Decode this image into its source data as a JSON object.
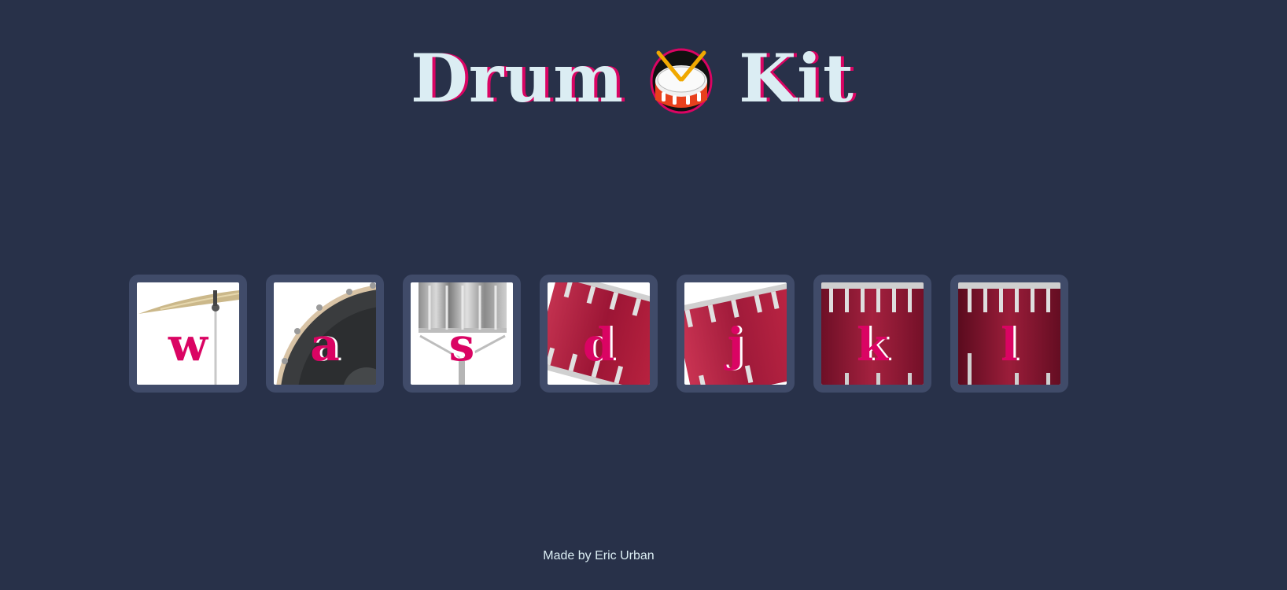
{
  "header": {
    "title_before": "Drum",
    "title_after": "Kit",
    "emoji_icon": "drum-emoji-icon"
  },
  "pads": [
    {
      "key": "w",
      "drum": "crash-cymbal"
    },
    {
      "key": "a",
      "drum": "kick-bass"
    },
    {
      "key": "s",
      "drum": "snare"
    },
    {
      "key": "d",
      "drum": "tom-1"
    },
    {
      "key": "j",
      "drum": "tom-2"
    },
    {
      "key": "k",
      "drum": "tom-3"
    },
    {
      "key": "l",
      "drum": "tom-4"
    }
  ],
  "footer": {
    "text": "Made by Eric Urban"
  },
  "colors": {
    "background": "#283149",
    "pad_border": "#404b69",
    "accent": "#da0463",
    "text_light": "#dbedf3"
  }
}
